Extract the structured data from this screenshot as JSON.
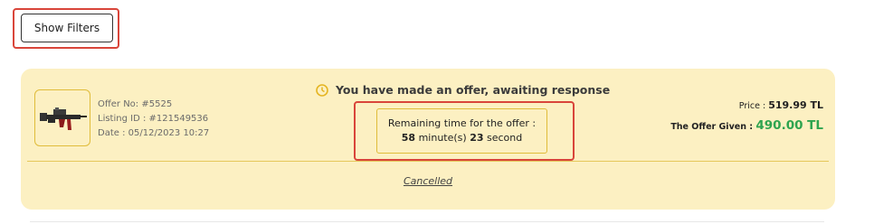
{
  "toolbar": {
    "show_filters_label": "Show Filters"
  },
  "offer": {
    "offer_no": "Offer No: #5525",
    "listing_id": "Listing ID : #121549536",
    "date": "Date : 05/12/2023 10:27",
    "status": "You have made an offer, awaiting response",
    "timer": {
      "label": "Remaining time for the offer :",
      "minutes": "58",
      "minutes_unit": " minute(s) ",
      "seconds": "23",
      "seconds_unit": " second"
    },
    "price_label": "Price : ",
    "price_value": "519.99 TL",
    "offer_given_label": "The Offer Given : ",
    "offer_given_value": "490.00 TL",
    "state_label": "Cancelled",
    "item_icon": "rifle-icon",
    "status_icon": "clock-icon"
  },
  "colors": {
    "card_bg": "#fcf0c2",
    "card_border": "#e0bc3a",
    "highlight": "#d9453a",
    "offer_green": "#2ea44f"
  }
}
